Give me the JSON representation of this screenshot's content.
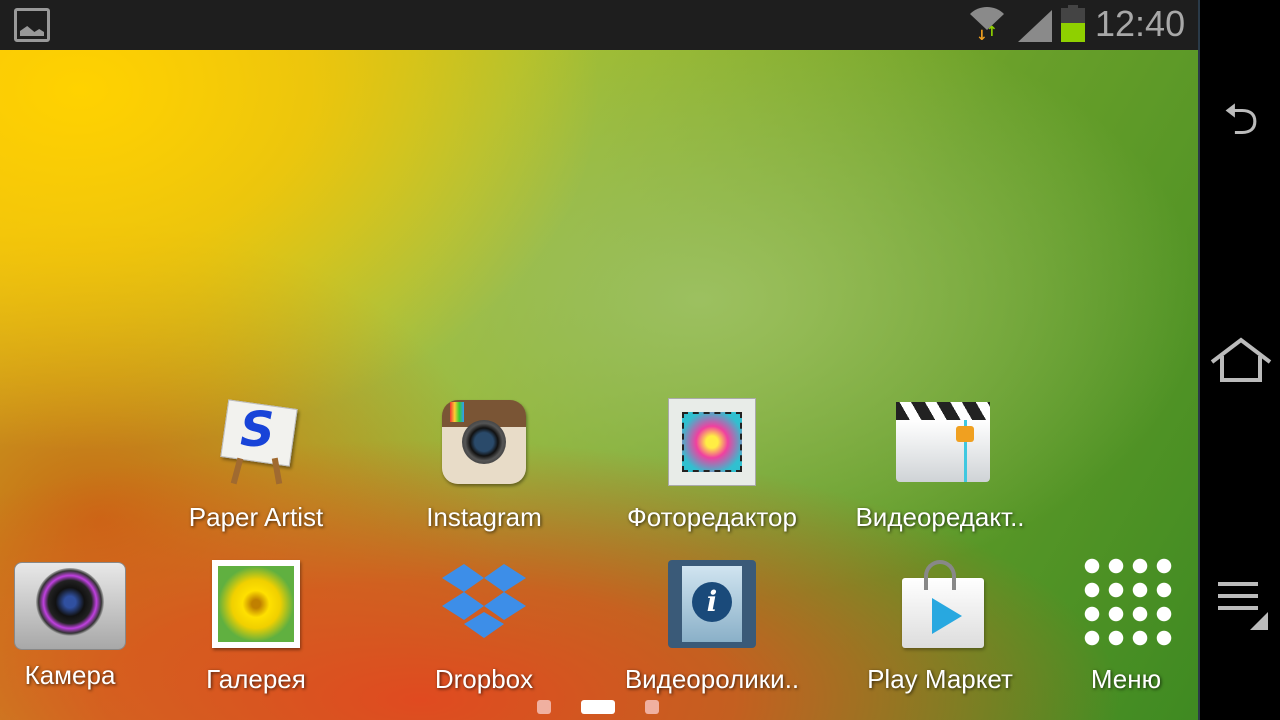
{
  "status_bar": {
    "time": "12:40",
    "battery_level": 0.55,
    "notification_icon": "gallery-image-icon",
    "wifi_icon": "wifi-icon",
    "signal_icon": "signal-icon"
  },
  "nav_bar": {
    "back": "back-icon",
    "home": "home-icon",
    "menu": "menu-icon"
  },
  "apps_row1": [
    {
      "label": "Paper Artist"
    },
    {
      "label": "Instagram"
    },
    {
      "label": "Фоторедактор"
    },
    {
      "label": "Видеоредакт.."
    }
  ],
  "dock": [
    {
      "label": "Камера"
    },
    {
      "label": "Галерея"
    },
    {
      "label": "Dropbox"
    },
    {
      "label": "Видеоролики.."
    },
    {
      "label": "Play Маркет"
    },
    {
      "label": "Меню"
    }
  ],
  "pages": {
    "count": 3,
    "current": 2
  },
  "colors": {
    "battery": "#8fd000",
    "statusbar": "#1e1e1e"
  }
}
